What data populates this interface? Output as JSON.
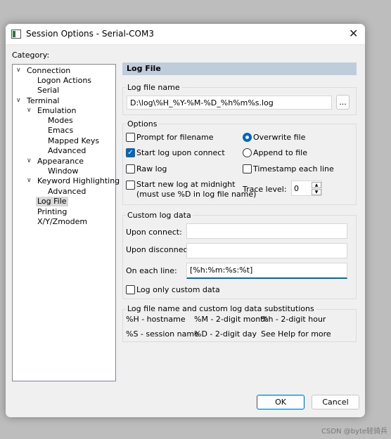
{
  "window": {
    "title": "Session Options - Serial-COM3",
    "close_glyph": "✕"
  },
  "category_label": "Category:",
  "tree": [
    {
      "label": "Connection",
      "caret": "∨"
    },
    {
      "label": "Logon Actions"
    },
    {
      "label": "Serial"
    },
    {
      "label": "Terminal",
      "caret": "∨"
    },
    {
      "label": "Emulation",
      "caret": "∨"
    },
    {
      "label": "Modes"
    },
    {
      "label": "Emacs"
    },
    {
      "label": "Mapped Keys"
    },
    {
      "label": "Advanced"
    },
    {
      "label": "Appearance",
      "caret": "∨"
    },
    {
      "label": "Window"
    },
    {
      "label": "Keyword Highlighting",
      "caret": "∨"
    },
    {
      "label": "Advanced"
    },
    {
      "label": "Log File",
      "selected": true
    },
    {
      "label": "Printing"
    },
    {
      "label": "X/Y/Zmodem"
    }
  ],
  "panel": {
    "header": "Log File",
    "log_name_group": "Log file name",
    "log_name_value": "D:\\log\\%H_%Y-%M-%D_%h%m%s.log",
    "browse_label": "...",
    "options_group": "Options",
    "opt_prompt": "Prompt for filename",
    "opt_start_connect": "Start log upon connect",
    "opt_raw": "Raw log",
    "opt_midnight_1": "Start new log at midnight",
    "opt_midnight_2": "(must use %D in log file name)",
    "opt_overwrite": "Overwrite file",
    "opt_append": "Append to file",
    "opt_timestamp": "Timestamp each line",
    "trace_label": "Trace level:",
    "trace_value": "0",
    "custom_group": "Custom log data",
    "upon_connect_label": "Upon connect:",
    "upon_connect_value": "",
    "upon_disconnect_label": "Upon disconnect:",
    "upon_disconnect_value": "",
    "each_line_label": "On each line:",
    "each_line_value": "[%h:%m:%s:%t]",
    "log_only_custom": "Log only custom data",
    "subs_group": "Log file name and custom log data substitutions",
    "subs": [
      "%H - hostname",
      "%M - 2-digit month",
      "%h - 2-digit hour",
      "%S - session name",
      "%D - 2-digit day",
      "See Help for more"
    ]
  },
  "buttons": {
    "ok": "OK",
    "cancel": "Cancel"
  },
  "watermark": "CSDN @byte轻骑兵",
  "colors": {
    "accent": "#0067c0",
    "header_bg": "#bfcddb"
  }
}
